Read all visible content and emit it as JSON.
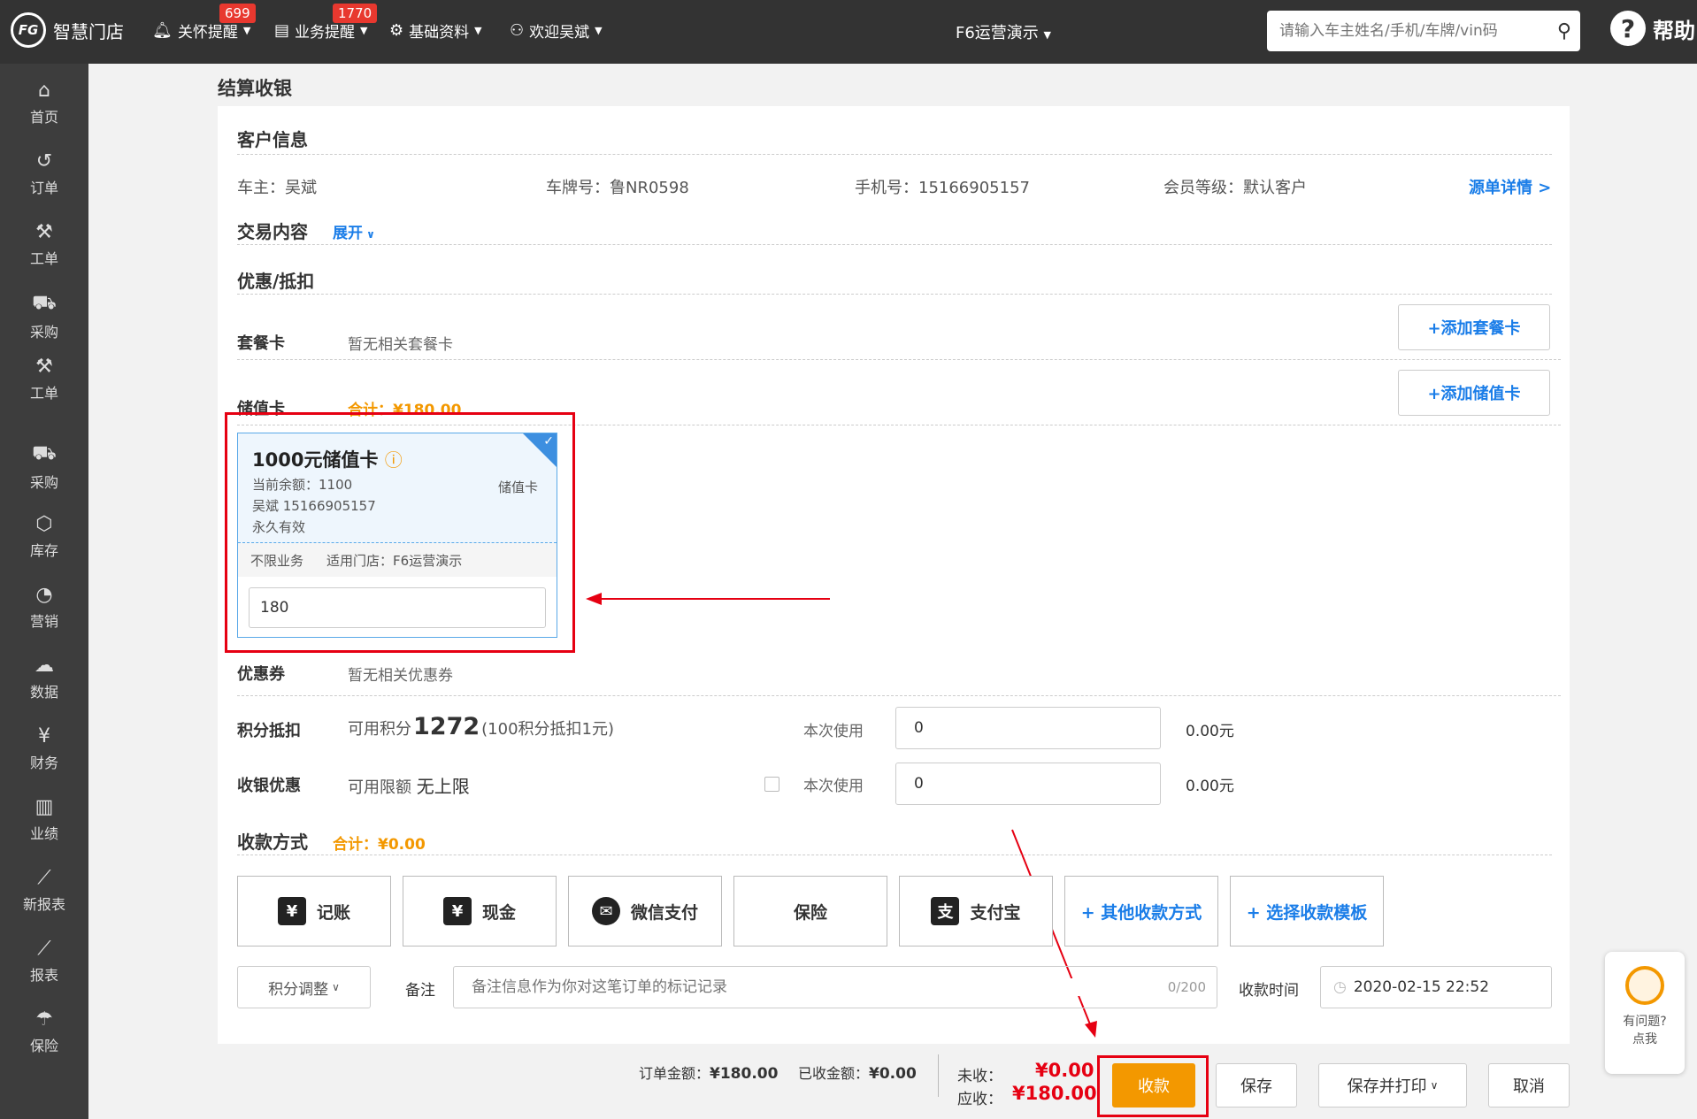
{
  "topbar": {
    "logo_mark": "FG",
    "logo_text": "智慧门店",
    "nav": [
      {
        "label": "关怀提醒",
        "badge": "699"
      },
      {
        "label": "业务提醒",
        "badge": "1770"
      },
      {
        "label": "基础资料"
      },
      {
        "label": "欢迎吴斌"
      }
    ],
    "store": "F6运营演示",
    "search_placeholder": "请输入车主姓名/手机/车牌/vin码",
    "help": "帮助"
  },
  "sidebar": [
    "首页",
    "订单",
    "工单",
    "采购",
    "工单",
    "采购",
    "库存",
    "营销",
    "数据",
    "财务",
    "业绩",
    "新报表",
    "报表",
    "保险"
  ],
  "page_title": "结算收银",
  "customer": {
    "section": "客户信息",
    "owner": "车主：吴斌",
    "plate": "车牌号：鲁NR0598",
    "phone": "手机号：15166905157",
    "level": "会员等级：默认客户",
    "detail_link": "源单详情 >"
  },
  "trade": {
    "section": "交易内容",
    "expand": "展开"
  },
  "discount": {
    "section": "优惠/抵扣",
    "package_label": "套餐卡",
    "package_empty": "暂无相关套餐卡",
    "add_package": "+添加套餐卡",
    "stored_label": "储值卡",
    "stored_total": "合计：¥180.00",
    "add_stored": "+添加储值卡",
    "card": {
      "name": "1000元储值卡",
      "balance": "当前余额：1100",
      "type": "储值卡",
      "holder": "吴斌  15166905157",
      "validity": "永久有效",
      "scope": "不限业务",
      "store": "适用门店：F6运营演示",
      "amount": "180"
    },
    "coupon_label": "优惠券",
    "coupon_empty": "暂无相关优惠券",
    "points_label": "积分抵扣",
    "points_prefix": "可用积分",
    "points_value": "1272",
    "points_rule": "(100积分抵扣1元)",
    "points_use_label": "本次使用",
    "points_use_value": "0",
    "points_amount": "0.00元",
    "cashier_label": "收银优惠",
    "cashier_limit_prefix": "可用限额",
    "cashier_limit": "无上限",
    "cashier_use_label": "本次使用",
    "cashier_use_value": "0",
    "cashier_amount": "0.00元"
  },
  "payment": {
    "section": "收款方式",
    "total": "合计：¥0.00",
    "methods": [
      "记账",
      "现金",
      "微信支付",
      "保险",
      "支付宝",
      "+ 其他收款方式",
      "+ 选择收款模板"
    ],
    "points_adjust": "积分调整",
    "remark_label": "备注",
    "remark_placeholder": "备注信息作为你对这笔订单的标记记录",
    "remark_count": "0/200",
    "time_label": "收款时间",
    "time_value": "2020-02-15 22:52"
  },
  "footer": {
    "order_amount_label": "订单金额：",
    "order_amount": "¥180.00",
    "received_label": "已收金额：",
    "received": "¥0.00",
    "unpaid_label": "未收：",
    "unpaid": "¥0.00",
    "due_label": "应收：",
    "due": "¥180.00",
    "collect": "收款",
    "save": "保存",
    "save_print": "保存并打印",
    "cancel": "取消"
  },
  "float_help": {
    "line1": "有问题?",
    "line2": "点我"
  },
  "colors": {
    "accent": "#1a7de8",
    "orange": "#f39800",
    "red": "#e60012",
    "topbar": "#333333",
    "sidebar": "#3d3d3d"
  }
}
